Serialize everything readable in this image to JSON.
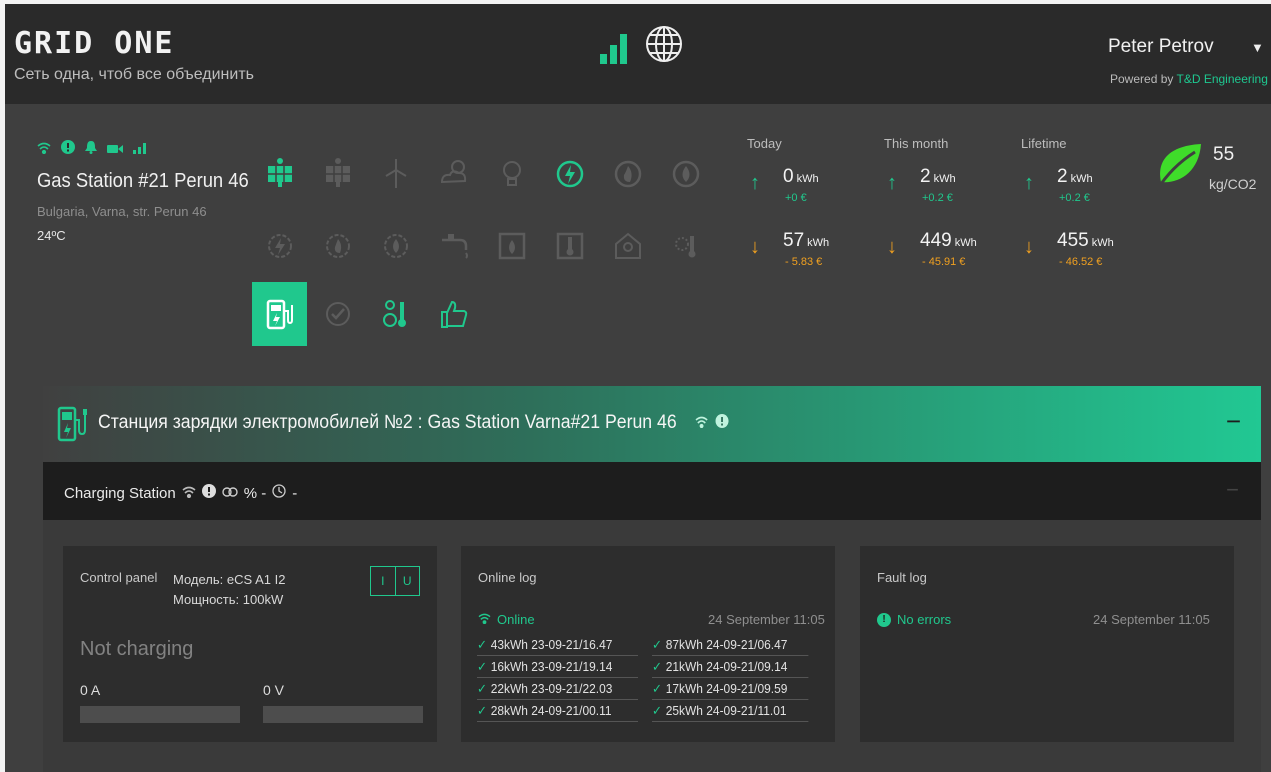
{
  "app": {
    "logo": "GRID ONE",
    "tagline": "Сеть одна, чтоб все объединить",
    "user_name": "Peter Petrov",
    "powered_prefix": "Powered by",
    "powered_link": "T&D Engineering"
  },
  "site": {
    "name": "Gas Station #21 Perun 46",
    "address": "Bulgaria, Varna, str. Perun 46",
    "temperature": "24ºC",
    "status_icons": [
      "wifi-icon",
      "alert-icon",
      "bell-icon",
      "camera-icon",
      "signal-icon"
    ],
    "device_icons": [
      {
        "name": "solar-panel-icon",
        "state": "on"
      },
      {
        "name": "solar-panel-icon",
        "state": "off"
      },
      {
        "name": "wind-turbine-icon",
        "state": "off"
      },
      {
        "name": "weather-icon",
        "state": "off"
      },
      {
        "name": "light-bulb-icon",
        "state": "off"
      },
      {
        "name": "electric-meter-icon",
        "state": "on"
      },
      {
        "name": "gas-meter-icon",
        "state": "off"
      },
      {
        "name": "water-meter-icon",
        "state": "off"
      },
      {
        "name": "electric-gauge-icon",
        "state": "off"
      },
      {
        "name": "gas-gauge-icon",
        "state": "off"
      },
      {
        "name": "water-gauge-icon",
        "state": "off"
      },
      {
        "name": "faucet-icon",
        "state": "off"
      },
      {
        "name": "water-tank-icon",
        "state": "off"
      },
      {
        "name": "thermometer-icon",
        "state": "off"
      },
      {
        "name": "smart-home-icon",
        "state": "off"
      },
      {
        "name": "temperature-sun-icon",
        "state": "off"
      },
      {
        "name": "ev-charger-icon",
        "state": "active"
      },
      {
        "name": "check-circle-icon",
        "state": "off"
      },
      {
        "name": "meter-thermometer-icon",
        "state": "on"
      },
      {
        "name": "thumbs-up-icon",
        "state": "on"
      }
    ]
  },
  "stats": {
    "unit": "kWh",
    "columns": [
      {
        "label": "Today",
        "in_kwh": "0",
        "in_money": "+0 €",
        "out_kwh": "57",
        "out_money": "- 5.83 €"
      },
      {
        "label": "This month",
        "in_kwh": "2",
        "in_money": "+0.2 €",
        "out_kwh": "449",
        "out_money": "- 45.91 €"
      },
      {
        "label": "Lifetime",
        "in_kwh": "2",
        "in_money": "+0.2 €",
        "out_kwh": "455",
        "out_money": "- 46.52 €"
      }
    ],
    "co2_value": "55",
    "co2_unit": "kg/CO2"
  },
  "device": {
    "title": "Станция зарядки электромобилей №2 : Gas Station Varna#21 Perun 46",
    "collapse": "−",
    "subtitle": "Charging Station",
    "percent": "% -",
    "timer": "-"
  },
  "control_panel": {
    "title": "Control panel",
    "model": "Модель: eCS A1 I2",
    "power": "Мощность: 100kW",
    "btn_i": "I",
    "btn_u": "U",
    "status": "Not charging",
    "current": "0 A",
    "voltage": "0 V"
  },
  "online_log": {
    "title": "Online log",
    "status": "Online",
    "date": "24 September 11:05",
    "entries": [
      "43kWh 23-09-21/16.47",
      "87kWh 24-09-21/06.47",
      "16kWh 23-09-21/19.14",
      "21kWh 24-09-21/09.14",
      "22kWh 23-09-21/22.03",
      "17kWh 24-09-21/09.59",
      "28kWh 24-09-21/00.11",
      "25kWh 24-09-21/11.01"
    ]
  },
  "fault_log": {
    "title": "Fault log",
    "status": "No errors",
    "date": "24 September 11:05"
  },
  "colors": {
    "accent": "#20c88d",
    "warning": "#f0a020",
    "background": "#3f3f3f",
    "topbar": "#2a2a2a"
  }
}
